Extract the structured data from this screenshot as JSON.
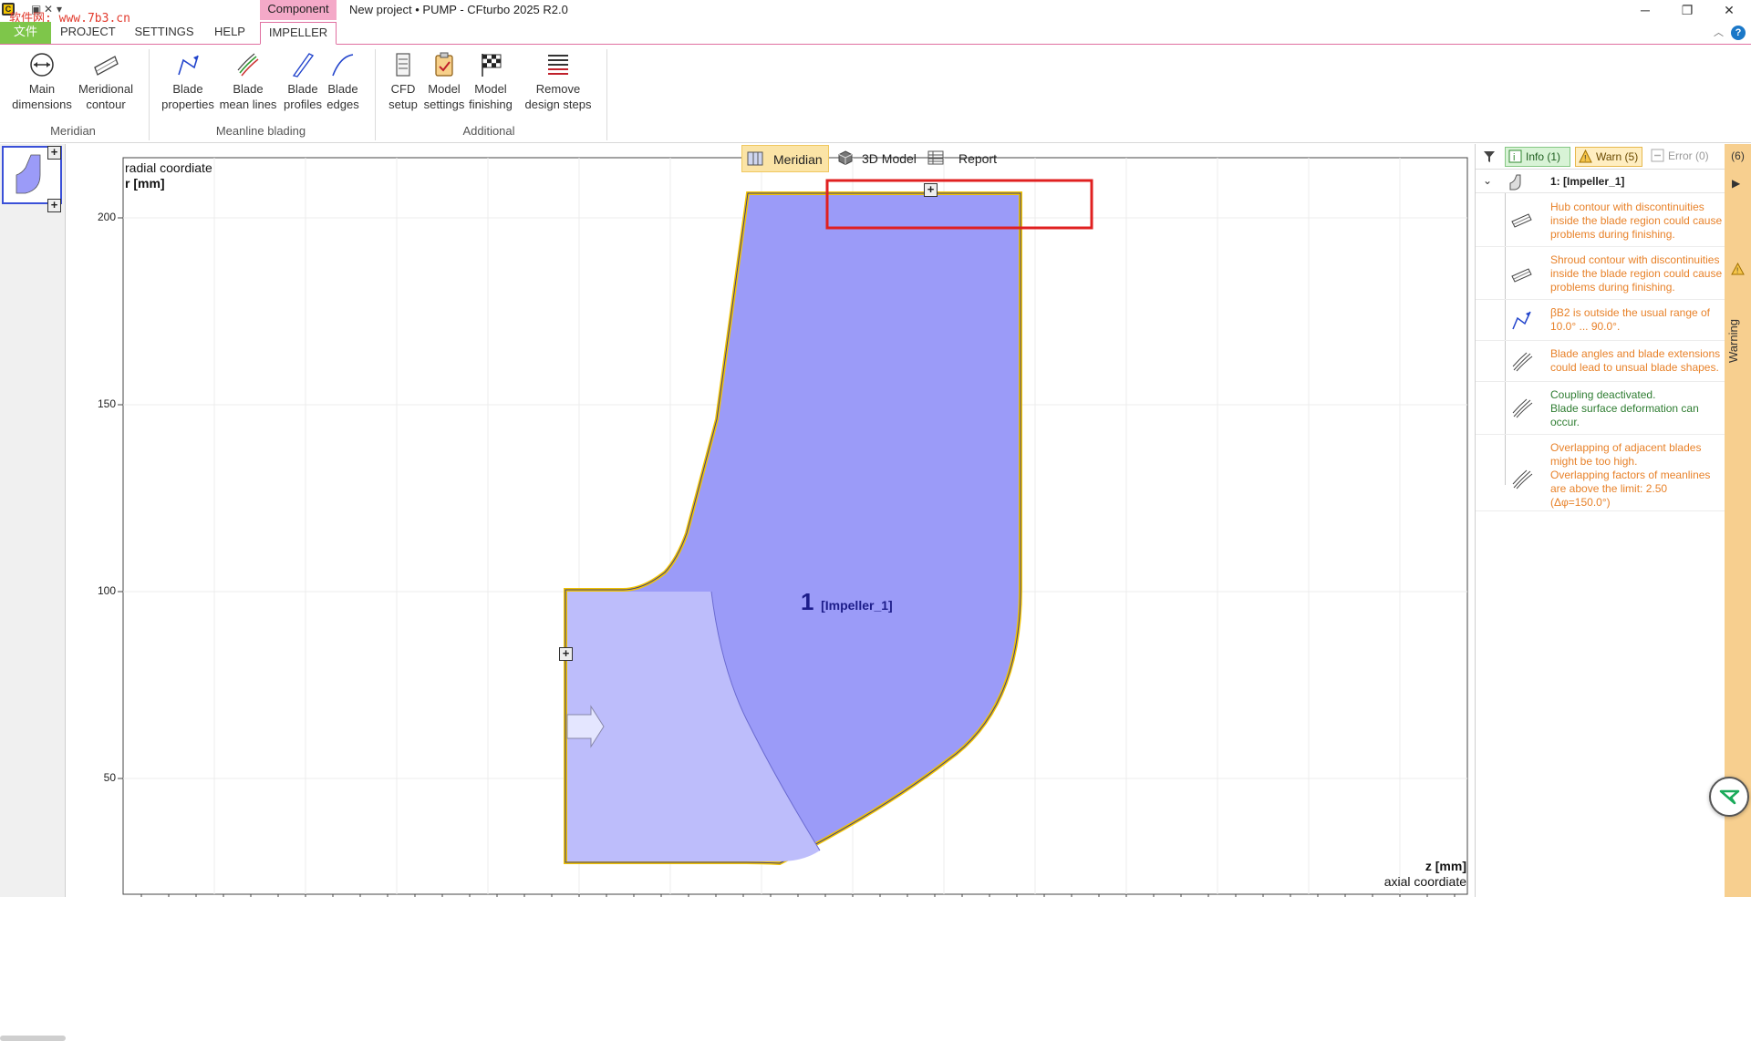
{
  "titlebar": {
    "watermark": "软件网: www.7b3.cn",
    "component_tab": "Component",
    "title": "New project • PUMP - CFturbo 2025 R2.0"
  },
  "menu": {
    "file": "文件",
    "project": "PROJECT",
    "settings": "SETTINGS",
    "help": "HELP",
    "impeller": "IMPELLER"
  },
  "ribbon": {
    "main_dimensions": "Main\ndimensions",
    "meridional_contour": "Meridional\ncontour",
    "group_meridian": "Meridian",
    "blade_properties": "Blade\nproperties",
    "blade_mean_lines": "Blade\nmean lines",
    "blade_profiles": "Blade\nprofiles",
    "blade_edges": "Blade\nedges",
    "group_meanline": "Meanline blading",
    "cfd_setup": "CFD\nsetup",
    "model_settings": "Model\nsettings",
    "model_finishing": "Model\nfinishing",
    "remove_design_steps": "Remove\ndesign steps",
    "group_additional": "Additional"
  },
  "view_switch": {
    "meridian": "Meridian",
    "model_3d": "3D Model",
    "report": "Report"
  },
  "plot": {
    "y_axis_title": "radial coordiate",
    "y_axis_unit": "r [mm]",
    "x_axis_unit": "z [mm]",
    "x_axis_title": "axial coordiate",
    "y_ticks": [
      "200",
      "150",
      "100",
      "50"
    ],
    "component_number": "1",
    "component_name": "[Impeller_1]"
  },
  "messages_panel": {
    "info_tab": "Info (1)",
    "warn_tab": "Warn (5)",
    "error_tab": "Error (0)",
    "tree_title": "1: [Impeller_1]",
    "items": [
      {
        "text": "Hub contour with discontinuities inside the blade region could cause problems during finishing.",
        "kind": "warning",
        "icon": "hub-contour-icon"
      },
      {
        "text": "Shroud contour with discontinuities inside the blade region could cause problems during finishing.",
        "kind": "warning",
        "icon": "shroud-contour-icon"
      },
      {
        "text": "βB2 is outside the usual range of 10.0° ... 90.0°.",
        "kind": "warning",
        "icon": "blade-angle-icon"
      },
      {
        "text": "Blade angles and blade extensions could lead to unsual blade shapes.",
        "kind": "warning",
        "icon": "blade-mean-lines-icon"
      },
      {
        "text": "Coupling deactivated.\nBlade surface deformation can occur.",
        "kind": "info",
        "icon": "blade-mean-lines-icon"
      },
      {
        "text": "Overlapping of adjacent blades might be too high.\nOverlapping factors of meanlines are above the limit: 2.50 (Δφ=150.0°)",
        "kind": "warning",
        "icon": "blade-mean-lines-icon"
      }
    ]
  },
  "sidebar": {
    "count": "(6)",
    "label": "Warning"
  },
  "colors": {
    "accent_pink": "#f4a9c8",
    "file_green": "#7ec64a",
    "warn_orange": "#e8822a",
    "info_green": "#2f7d32",
    "impeller_fill": "#9b9bf8",
    "inlet_fill": "#bdbdfb",
    "outline_yellow": "#f2c400",
    "highlight_red": "#e02020"
  }
}
